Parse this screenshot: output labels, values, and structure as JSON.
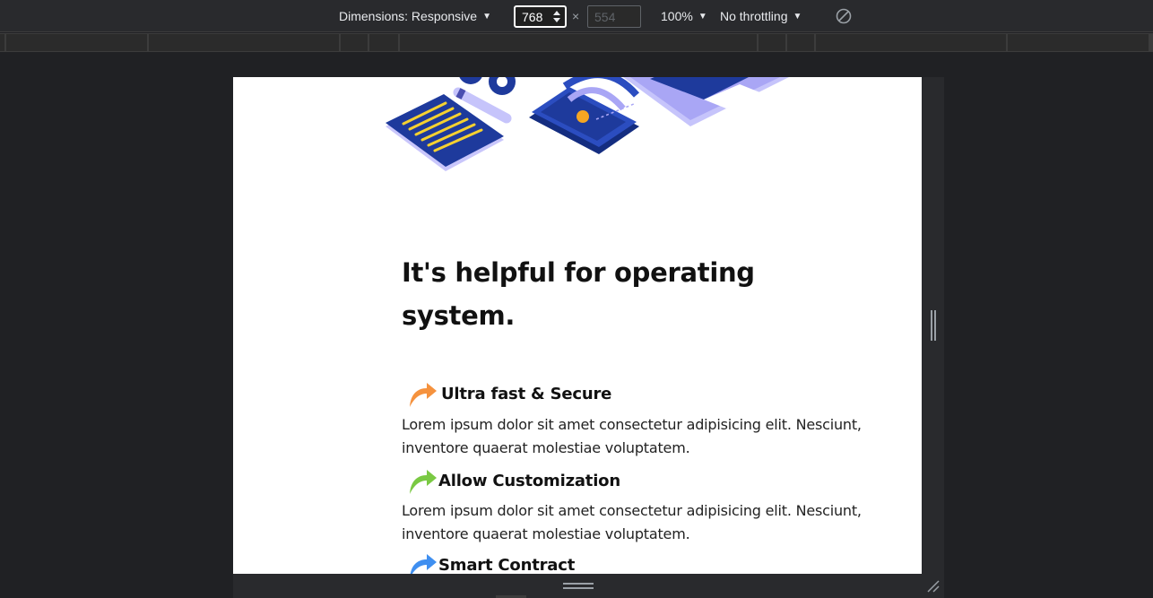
{
  "toolbar": {
    "dimensions_label": "Dimensions: Responsive",
    "width_value": "768",
    "times_symbol": "×",
    "height_value": "554",
    "zoom_label": "100%",
    "throttling_label": "No throttling",
    "rotate_icon": "rotate-disabled-icon"
  },
  "page": {
    "heading": "It's helpful for operating system.",
    "features": [
      {
        "title": "Ultra fast & Secure",
        "arrow_color": "#f5923e",
        "body": "Lorem ipsum dolor sit amet consectetur adipisicing elit. Nesciunt, inventore quaerat molestiae voluptatem."
      },
      {
        "title": "Allow Customization",
        "arrow_color": "#7ac943",
        "body": "Lorem ipsum dolor sit amet consectetur adipisicing elit. Nesciunt, inventore quaerat molestiae voluptatem."
      },
      {
        "title": "Smart Contract",
        "arrow_color": "#3f8ff0",
        "body": ""
      }
    ]
  },
  "colors": {
    "illustration_dark_blue": "#1e3a9c",
    "illustration_lavender": "#a9a6f5",
    "illustration_yellow": "#f5d130"
  }
}
